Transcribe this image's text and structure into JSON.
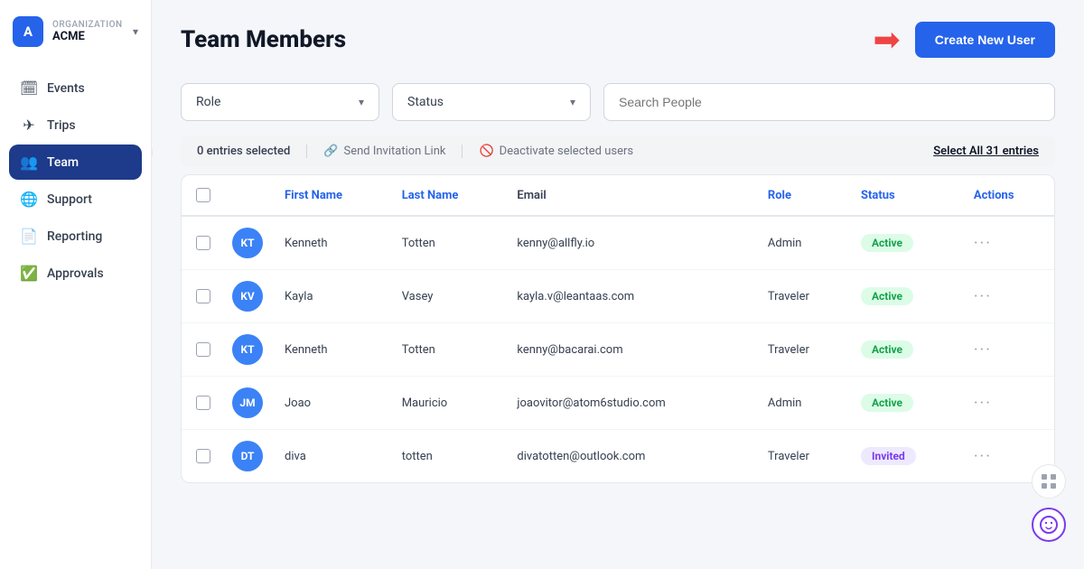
{
  "sidebar": {
    "org": {
      "label": "Organization",
      "name": "ACME",
      "initial": "A"
    },
    "items": [
      {
        "id": "events",
        "label": "Events",
        "icon": "🗓"
      },
      {
        "id": "trips",
        "label": "Trips",
        "icon": "✈"
      },
      {
        "id": "team",
        "label": "Team",
        "icon": "👥",
        "active": true
      },
      {
        "id": "support",
        "label": "Support",
        "icon": "🌐"
      },
      {
        "id": "reporting",
        "label": "Reporting",
        "icon": "📄"
      },
      {
        "id": "approvals",
        "label": "Approvals",
        "icon": "✅"
      }
    ]
  },
  "header": {
    "title": "Team Members",
    "create_button": "Create New User"
  },
  "filters": {
    "role_label": "Role",
    "status_label": "Status",
    "search_placeholder": "Search People"
  },
  "selection_bar": {
    "entries_selected": "0 entries selected",
    "send_invitation": "Send Invitation Link",
    "deactivate": "Deactivate selected users",
    "select_all": "Select All 31 entries"
  },
  "table": {
    "headers": [
      "",
      "",
      "First Name",
      "Last Name",
      "Email",
      "Role",
      "Status",
      "Actions"
    ],
    "rows": [
      {
        "initials": "KT",
        "avatar_color": "#3b82f6",
        "first_name": "Kenneth",
        "last_name": "Totten",
        "email": "kenny@allfly.io",
        "role": "Admin",
        "status": "Active",
        "status_type": "active"
      },
      {
        "initials": "KV",
        "avatar_color": "#3b82f6",
        "first_name": "Kayla",
        "last_name": "Vasey",
        "email": "kayla.v@leantaas.com",
        "role": "Traveler",
        "status": "Active",
        "status_type": "active"
      },
      {
        "initials": "KT",
        "avatar_color": "#3b82f6",
        "first_name": "Kenneth",
        "last_name": "Totten",
        "email": "kenny@bacarai.com",
        "role": "Traveler",
        "status": "Active",
        "status_type": "active"
      },
      {
        "initials": "JM",
        "avatar_color": "#3b82f6",
        "first_name": "Joao",
        "last_name": "Mauricio",
        "email": "joaovitor@atom6studio.com",
        "role": "Admin",
        "status": "Active",
        "status_type": "active"
      },
      {
        "initials": "DT",
        "avatar_color": "#3b82f6",
        "first_name": "diva",
        "last_name": "totten",
        "email": "divatotten@outlook.com",
        "role": "Traveler",
        "status": "Invited",
        "status_type": "invited"
      }
    ]
  }
}
